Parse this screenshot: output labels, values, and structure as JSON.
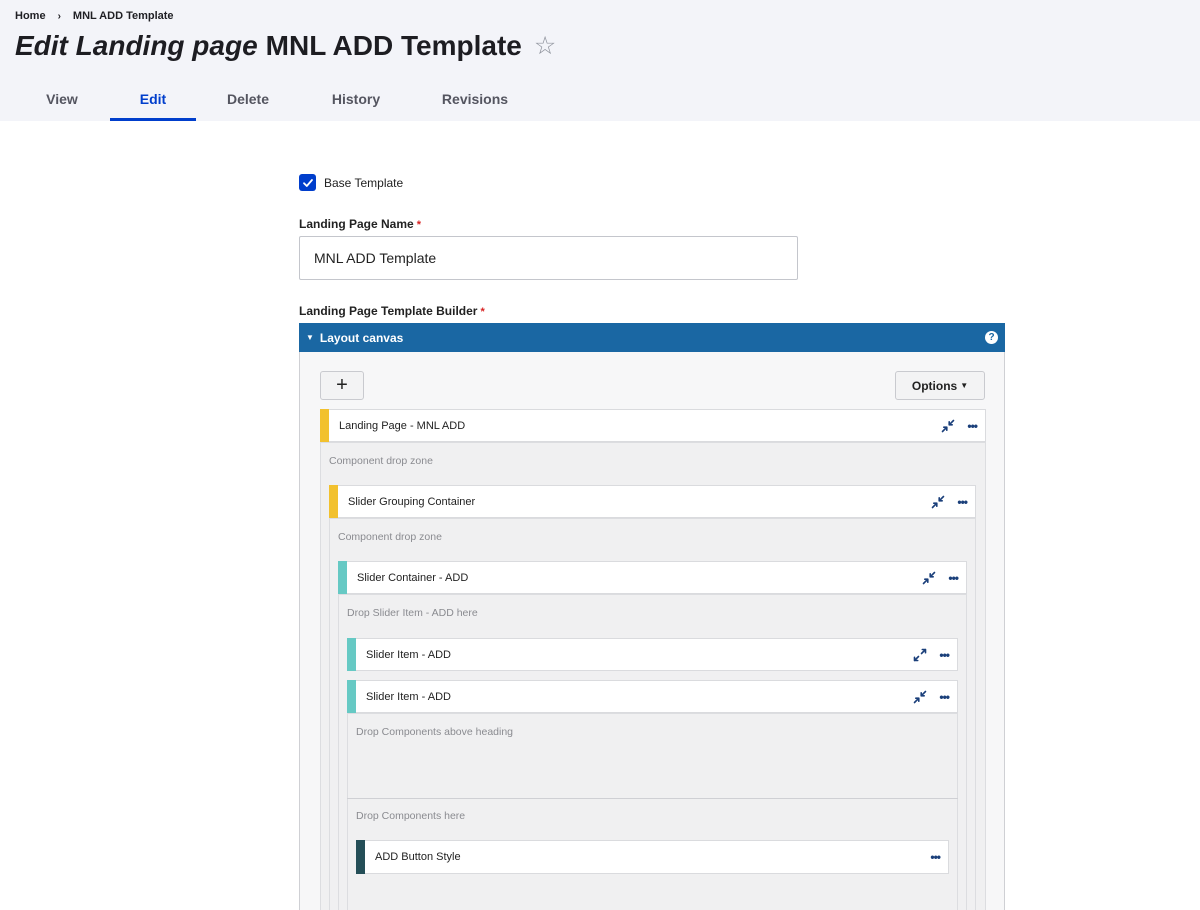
{
  "breadcrumb": {
    "home": "Home",
    "separator": "›",
    "current": "MNL ADD Template"
  },
  "title": {
    "prefix": "Edit Landing page",
    "name": "MNL ADD Template",
    "star": "☆"
  },
  "tabs": [
    {
      "label": "View",
      "active": false
    },
    {
      "label": "Edit",
      "active": true
    },
    {
      "label": "Delete",
      "active": false
    },
    {
      "label": "History",
      "active": false
    },
    {
      "label": "Revisions",
      "active": false
    }
  ],
  "form": {
    "base_template": {
      "label": "Base Template",
      "checked": true
    },
    "name_field": {
      "label": "Landing Page Name",
      "required_mark": "*",
      "value": "MNL ADD Template"
    },
    "builder_label": "Landing Page Template Builder",
    "builder_required_mark": "*"
  },
  "canvas": {
    "title": "Layout canvas",
    "add_button": "+",
    "options_button": "Options",
    "components": [
      {
        "name": "Landing Page - MNL ADD",
        "bar_color": "#f2c12e",
        "icon": "collapse-icon"
      },
      {
        "name": "Slider Grouping Container",
        "bar_color": "#f2c12e",
        "icon": "collapse-icon"
      },
      {
        "name": "Slider Container - ADD",
        "bar_color": "#66c9c4",
        "icon": "collapse-icon"
      },
      {
        "name": "Slider Item - ADD",
        "bar_color": "#66c9c4",
        "icon": "expand-icon"
      },
      {
        "name": "Slider Item - ADD",
        "bar_color": "#66c9c4",
        "icon": "collapse-icon"
      },
      {
        "name": "ADD Button Style",
        "bar_color": "#244e57",
        "icon": ""
      }
    ],
    "drop_zones": [
      "Component drop zone",
      "Component drop zone",
      "Drop Slider Item - ADD here",
      "Drop Components above heading",
      "Drop Components here"
    ],
    "menu_glyph": "•••"
  },
  "colors": {
    "accent": "#003ecc",
    "canvas_bar": "#1a67a3",
    "required": "#d72222"
  }
}
